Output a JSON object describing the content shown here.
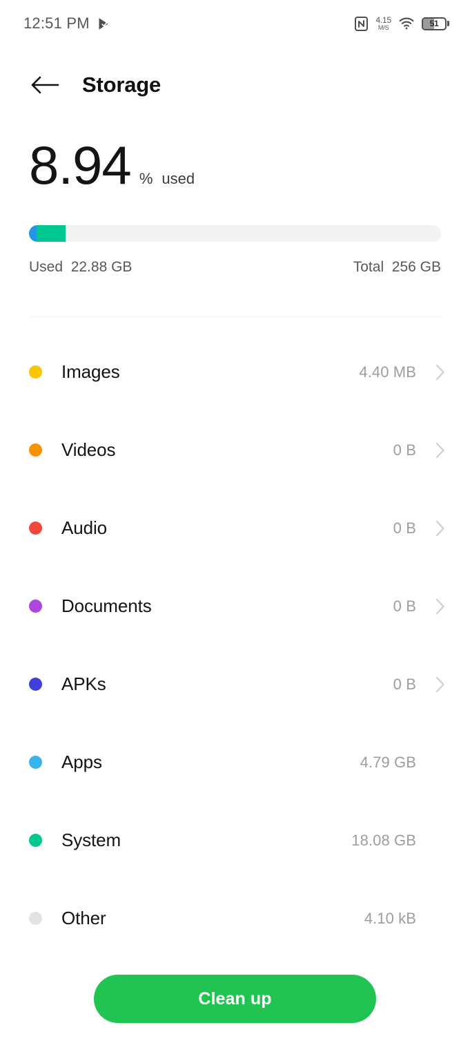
{
  "status_bar": {
    "time": "12:51 PM",
    "play_icon": "play-badge-icon",
    "nfc_icon": "nfc-icon",
    "network_speed_value": "4.15",
    "network_speed_unit": "M/S",
    "wifi_icon": "wifi-icon",
    "battery_level": "51",
    "battery_percent": 51
  },
  "app_bar": {
    "back_icon": "back-arrow-icon",
    "title": "Storage"
  },
  "summary": {
    "percent_used": "8.94",
    "percent_sign": "%",
    "used_word": "used",
    "used_label": "Used",
    "used_value": "22.88 GB",
    "total_label": "Total",
    "total_value": "256 GB",
    "bar_segments": [
      {
        "name": "Apps",
        "color": "#2196e8",
        "width_pct": 1.8
      },
      {
        "name": "System",
        "color": "#00c68f",
        "width_pct": 7.14
      }
    ],
    "track_color": "#f1f3f4"
  },
  "categories": [
    {
      "label": "Images",
      "size": "4.40 MB",
      "color": "#f7c600",
      "has_chevron": true
    },
    {
      "label": "Videos",
      "size": "0 B",
      "color": "#f99200",
      "has_chevron": true
    },
    {
      "label": "Audio",
      "size": "0 B",
      "color": "#f0483c",
      "has_chevron": true
    },
    {
      "label": "Documents",
      "size": "0 B",
      "color": "#ab47e0",
      "has_chevron": true
    },
    {
      "label": "APKs",
      "size": "0 B",
      "color": "#4040d8",
      "has_chevron": true
    },
    {
      "label": "Apps",
      "size": "4.79 GB",
      "color": "#3cb2ec",
      "has_chevron": false
    },
    {
      "label": "System",
      "size": "18.08 GB",
      "color": "#00c68f",
      "has_chevron": false
    },
    {
      "label": "Other",
      "size": "4.10 kB",
      "color": "#e3e3e3",
      "has_chevron": false
    }
  ],
  "cleanup": {
    "label": "Clean up",
    "color": "#21c353"
  }
}
